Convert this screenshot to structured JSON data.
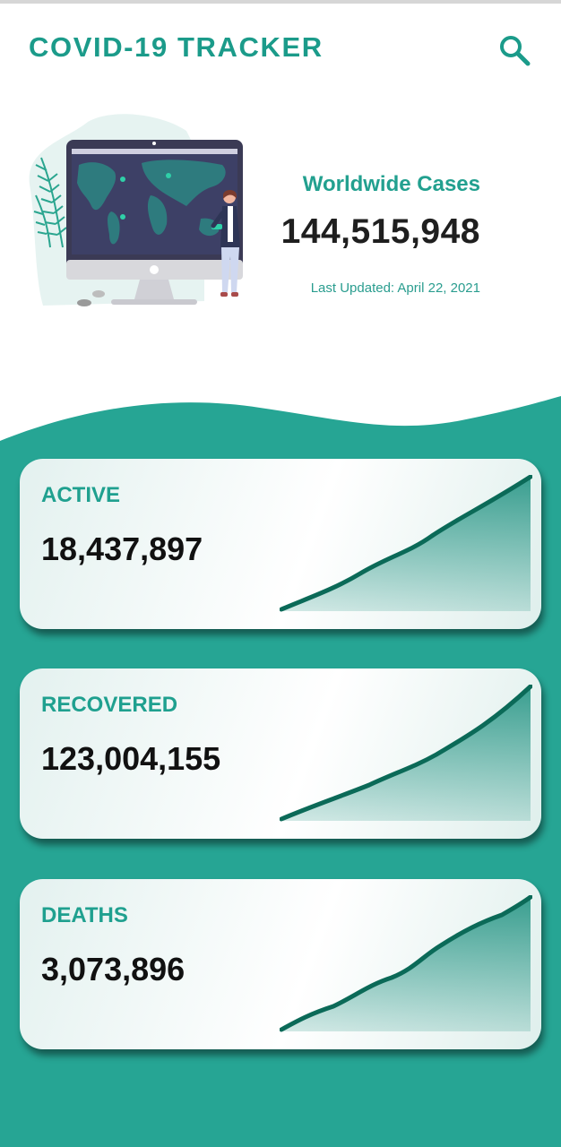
{
  "header": {
    "title": "COVID-19 TRACKER",
    "search_icon": "search-icon"
  },
  "hero": {
    "label": "Worldwide Cases",
    "value": "144,515,948",
    "last_updated": "Last Updated: April 22, 2021",
    "illustration_icon": "world-map-monitor-illustration"
  },
  "stats": [
    {
      "label": "ACTIVE",
      "value": "18,437,897",
      "trend_icon": "trend-up-area-icon"
    },
    {
      "label": "RECOVERED",
      "value": "123,004,155",
      "trend_icon": "trend-up-area-icon"
    },
    {
      "label": "DEATHS",
      "value": "3,073,896",
      "trend_icon": "trend-up-area-icon"
    }
  ],
  "colors": {
    "accent": "#1b9b8a",
    "teal_background": "#26a594",
    "line": "#0b6a58",
    "value_text": "#111111"
  }
}
